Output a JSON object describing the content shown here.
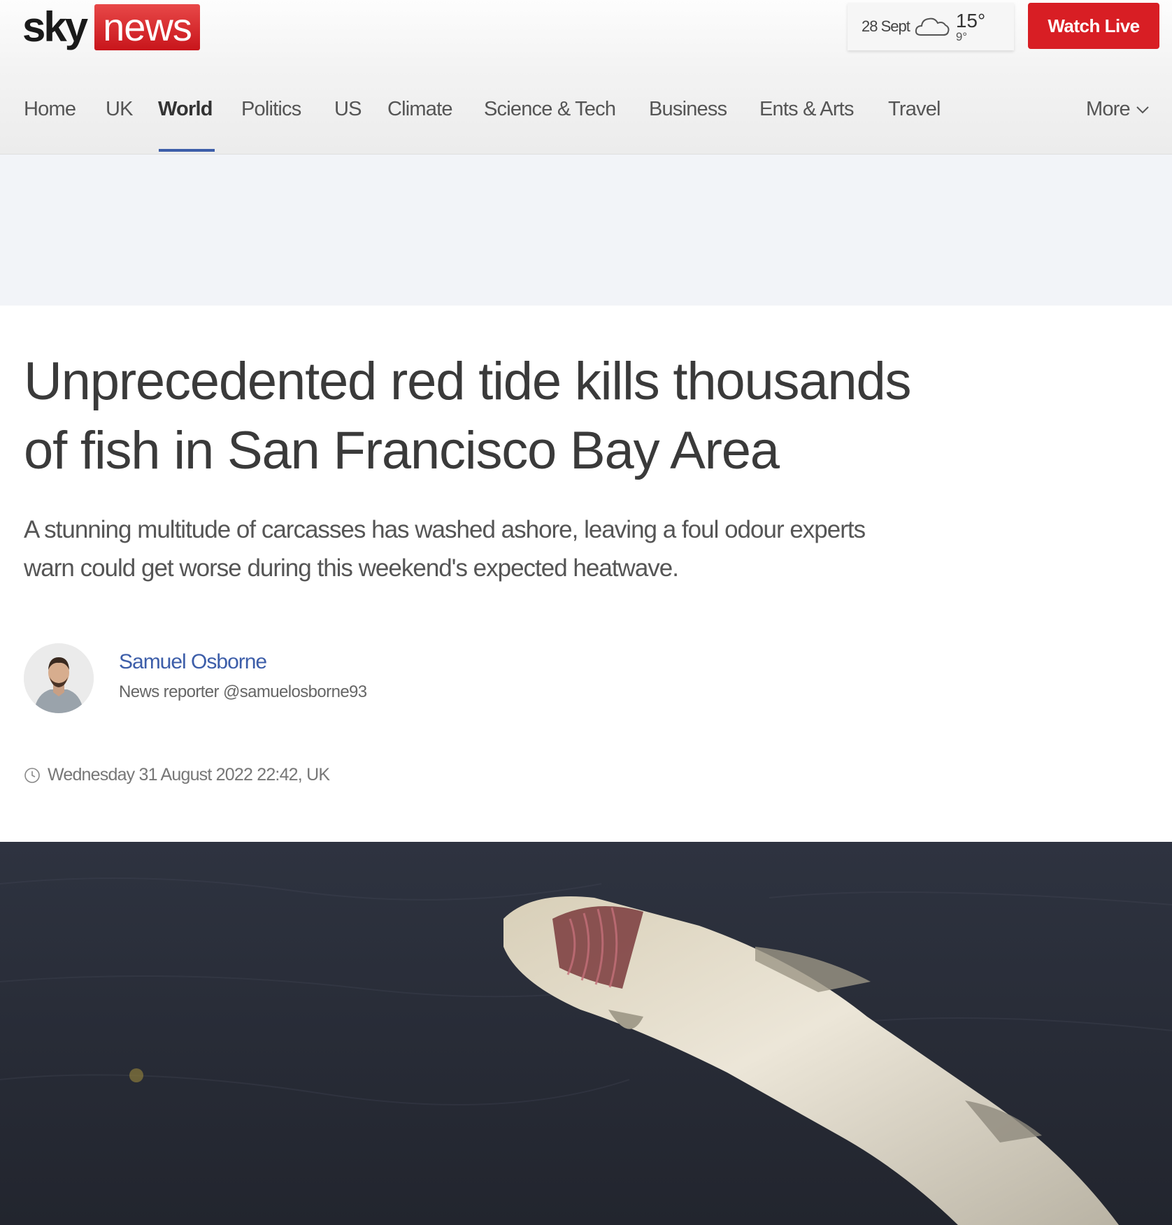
{
  "brand": {
    "sky": "sky",
    "news": "news"
  },
  "weather": {
    "date": "28 Sept",
    "icon": "cloud-icon",
    "high": "15°",
    "low": "9°"
  },
  "header": {
    "watch_live": "Watch Live"
  },
  "nav": {
    "items": [
      {
        "label": "Home"
      },
      {
        "label": "UK"
      },
      {
        "label": "World",
        "active": true
      },
      {
        "label": "Politics"
      },
      {
        "label": "US"
      },
      {
        "label": "Climate"
      },
      {
        "label": "Science & Tech"
      },
      {
        "label": "Business"
      },
      {
        "label": "Ents & Arts"
      },
      {
        "label": "Travel"
      }
    ],
    "more": "More"
  },
  "article": {
    "headline_line1": "Unprecedented red tide kills thousands",
    "headline_line2": "of fish in San Francisco Bay Area",
    "standfirst_line1": "A stunning multitude of carcasses has washed ashore, leaving a foul odour experts",
    "standfirst_line2": "warn could get worse during this weekend's expected heatwave.",
    "author_name": "Samuel Osborne",
    "author_role": "News reporter",
    "author_handle": "@samuelosborne93",
    "timestamp": "Wednesday 31 August 2022 22:42, UK"
  },
  "colors": {
    "brand_red": "#d81e24",
    "nav_accent": "#3d5ea9",
    "link_blue": "#3d5ea9"
  }
}
